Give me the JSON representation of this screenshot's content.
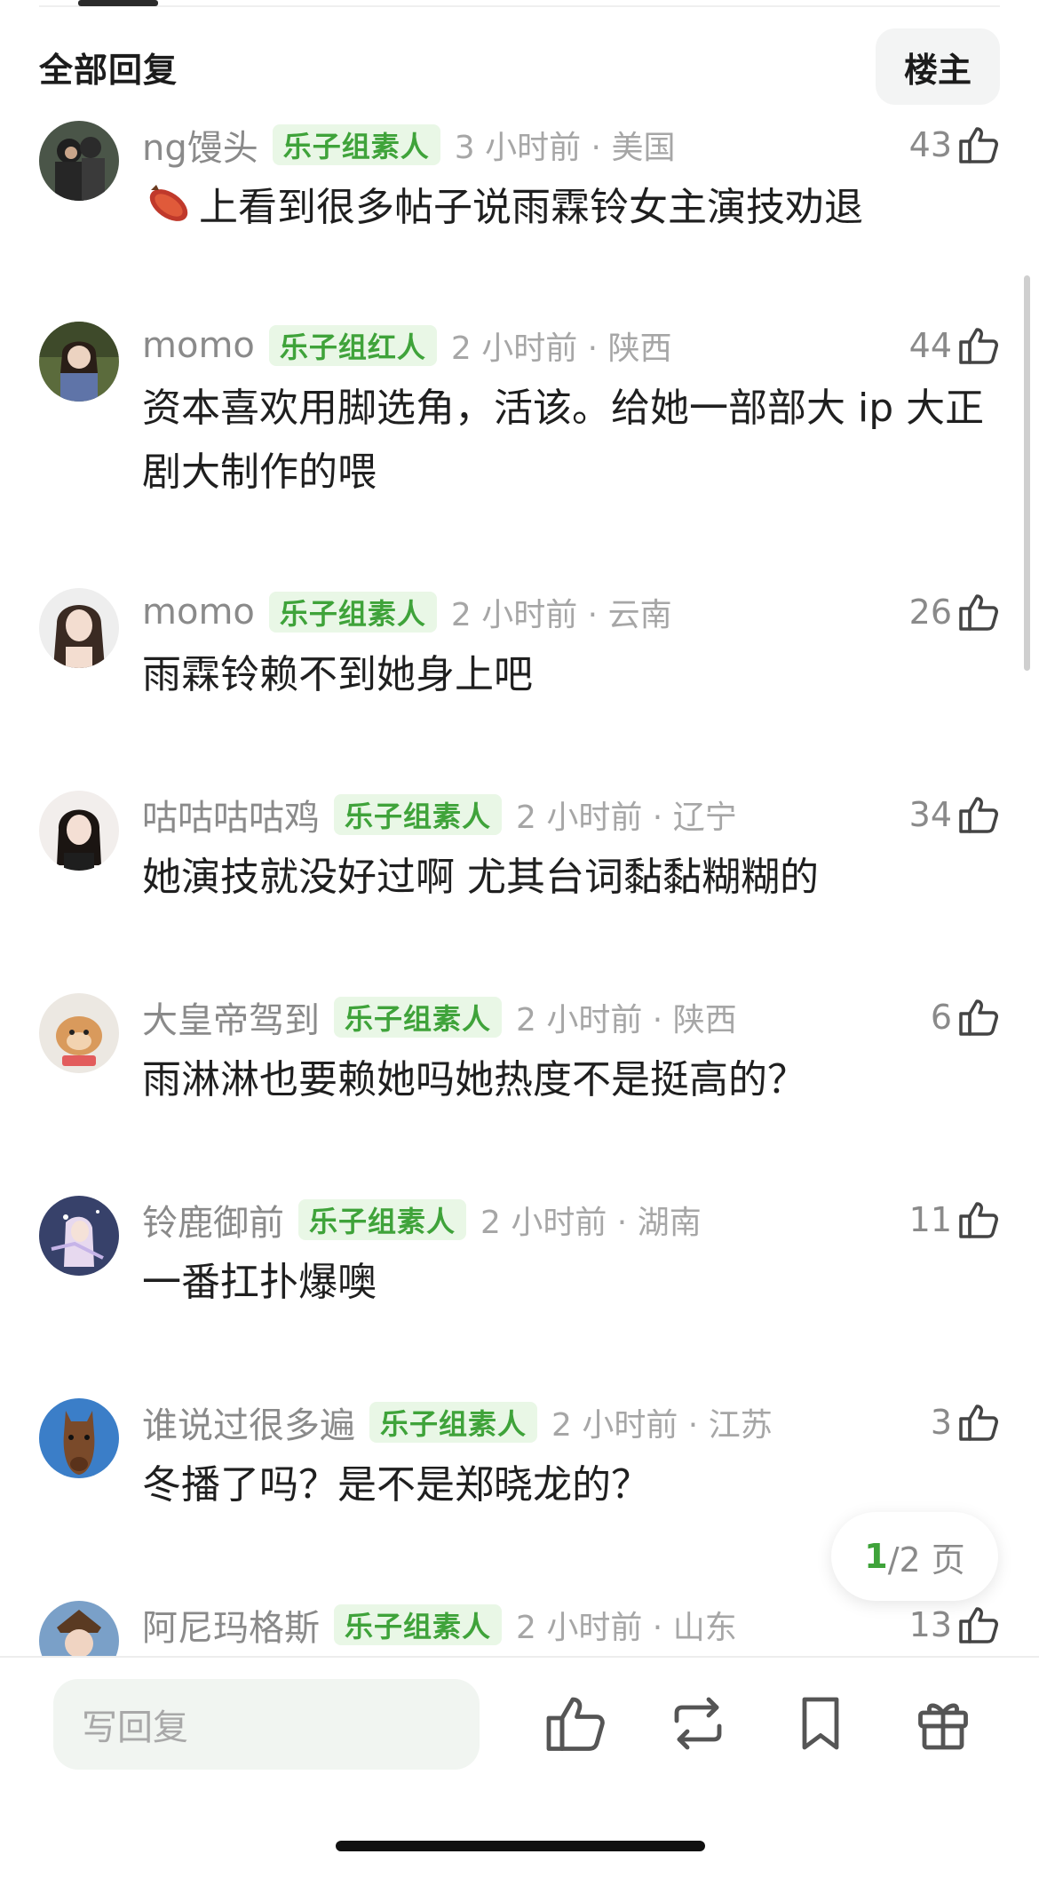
{
  "header": {
    "title": "全部回复",
    "op_label": "楼主"
  },
  "comments": [
    {
      "user": "ng馒头",
      "badge": "乐子组素人",
      "time": "3 小时前 · 美国",
      "likes": "43",
      "text": "上看到很多帖子说雨霖铃女主演技劝退"
    },
    {
      "user": "momo",
      "badge": "乐子组红人",
      "time": "2 小时前 · 陕西",
      "likes": "44",
      "text": "资本喜欢用脚选角，活该。给她一部部大 ip 大正剧大制作的喂"
    },
    {
      "user": "momo",
      "badge": "乐子组素人",
      "time": "2 小时前 · 云南",
      "likes": "26",
      "text": "雨霖铃赖不到她身上吧"
    },
    {
      "user": "咕咕咕咕鸡",
      "badge": "乐子组素人",
      "time": "2 小时前 · 辽宁",
      "likes": "34",
      "text": "她演技就没好过啊 尤其台词黏黏糊糊的"
    },
    {
      "user": "大皇帝驾到",
      "badge": "乐子组素人",
      "time": "2 小时前 · 陕西",
      "likes": "6",
      "text": "雨淋淋也要赖她吗她热度不是挺高的？"
    },
    {
      "user": "铃鹿御前",
      "badge": "乐子组素人",
      "time": "2 小时前 · 湖南",
      "likes": "11",
      "text": "一番扛扑爆噢"
    },
    {
      "user": "谁说过很多遍",
      "badge": "乐子组素人",
      "time": "2 小时前 · 江苏",
      "likes": "3",
      "text": "冬播了吗？是不是郑晓龙的？"
    },
    {
      "user": "阿尼玛格斯",
      "badge": "乐子组素人",
      "time": "2 小时前 · 山东",
      "likes": "13",
      "text": ""
    }
  ],
  "pager": {
    "current": "1",
    "rest": "/2 页"
  },
  "bottom": {
    "reply_placeholder": "写回复"
  },
  "colors": {
    "accent_green": "#3fa33a",
    "badge_bg": "#e9f7e6",
    "meta_gray": "#8a8a8a"
  },
  "icons": [
    "thumbs-up-icon",
    "repost-icon",
    "bookmark-icon",
    "gift-icon",
    "sweet-potato-icon"
  ]
}
